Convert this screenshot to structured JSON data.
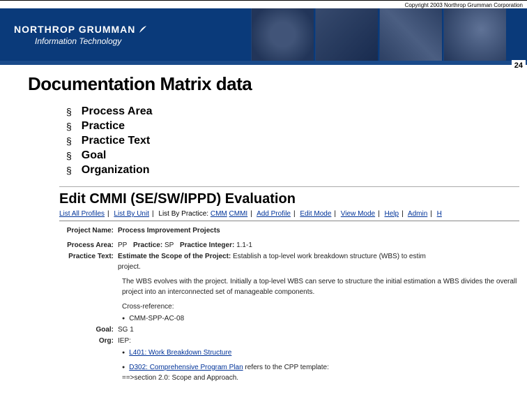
{
  "copyright": "Copyright 2003 Northrop Grumman Corporation",
  "company": "NORTHROP GRUMMAN",
  "division": "Information Technology",
  "page_number": "24",
  "slide_title": "Documentation Matrix data",
  "bullets": [
    "Process Area",
    "Practice",
    "Practice Text",
    "Goal",
    "Organization"
  ],
  "screenshot": {
    "title": "Edit CMMI (SE/SW/IPPD) Evaluation",
    "nav": {
      "list_all_profiles": "List All Profiles",
      "list_by_unit": "List By Unit",
      "list_by_practice": "List By Practice:",
      "cmm": "CMM",
      "cmmi": "CMMI",
      "add_profile": "Add Profile",
      "edit_mode": "Edit Mode",
      "view_mode": "View Mode",
      "help": "Help",
      "admin": "Admin",
      "h": "H"
    },
    "project_name_label": "Project Name:",
    "project_name": "Process Improvement Projects",
    "process_area_label": "Process Area:",
    "process_area": "PP",
    "practice_label": "Practice:",
    "practice": "SP",
    "practice_integer_label": "Practice Integer:",
    "practice_integer": "1.1-1",
    "practice_text_label": "Practice Text:",
    "practice_text_title": "Estimate the Scope of the Project:",
    "practice_text_body": "Establish a top-level work breakdown structure (WBS) to estim",
    "practice_text_tail": "project.",
    "para": "The WBS evolves with the project. Initially a top-level WBS can serve to structure the initial estimation a WBS divides the overall project into an interconnected set of manageable components.",
    "crossref_label": "Cross-reference:",
    "crossref_item": "CMM-SPP-AC-08",
    "goal_label": "Goal:",
    "goal": "SG 1",
    "org_label": "Org:",
    "org": "IEP:",
    "org_link1": "L401: Work Breakdown Structure",
    "org_link2": "D302: Comprehensive Program Plan",
    "org_tail": " refers to the CPP template:",
    "org_extra": "==>section 2.0: Scope and Approach."
  }
}
